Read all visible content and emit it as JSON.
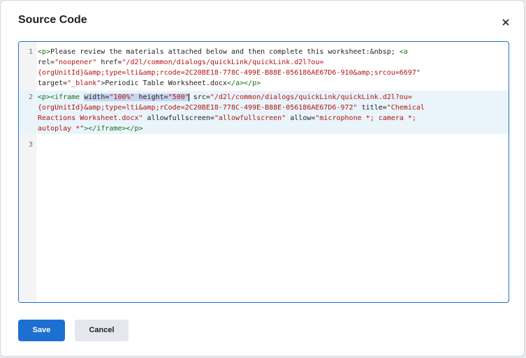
{
  "dialog": {
    "title": "Source Code",
    "close_icon": "close-icon"
  },
  "editor": {
    "line_numbers": [
      "1",
      "2",
      "3"
    ],
    "line1": {
      "r1a": "<p>",
      "r1b": "Please review the materials attached below and then complete this worksheet:&nbsp; ",
      "r1c": "<a",
      "r2a": "rel=",
      "r2b": "\"noopener\"",
      "r2c": " href=",
      "r2d": "\"/d2l/common/dialogs/quickLink/quickLink.d2l?ou=",
      "r3a": "{orgUnitId}&amp;type=lti&amp;rcode=2C20BE18-778C-499E-B88E-056186AE67D6-910&amp;srcou=6697\"",
      "r4a": "target=",
      "r4b": "\"_blank\"",
      "r4c": ">Periodic Table Worksheet.docx",
      "r4d": "</a></p>"
    },
    "line2": {
      "r1a": "<p><iframe ",
      "r1sel_a": "width=",
      "r1sel_b": "\"100%\"",
      "r1sel_c": " height=",
      "r1sel_d": "\"500\"",
      "r1b": " src=",
      "r1c": "\"/d2l/common/dialogs/quickLink/quickLink.d2l?ou=",
      "r2a": "{orgUnitId}&amp;type=lti&amp;rCode=2C20BE18-778C-499E-B88E-056186AE67D6-972\"",
      "r2b": " title=",
      "r2c": "\"Chemical",
      "r3a": "Reactions Worksheet.docx\"",
      "r3b": " allowfullscreen=",
      "r3c": "\"allowfullscreen\"",
      "r3d": " allow=",
      "r3e": "\"microphone *; camera *;",
      "r4a": "autoplay *\"",
      "r4b": "></iframe></p>"
    }
  },
  "buttons": {
    "save": "Save",
    "cancel": "Cancel"
  }
}
